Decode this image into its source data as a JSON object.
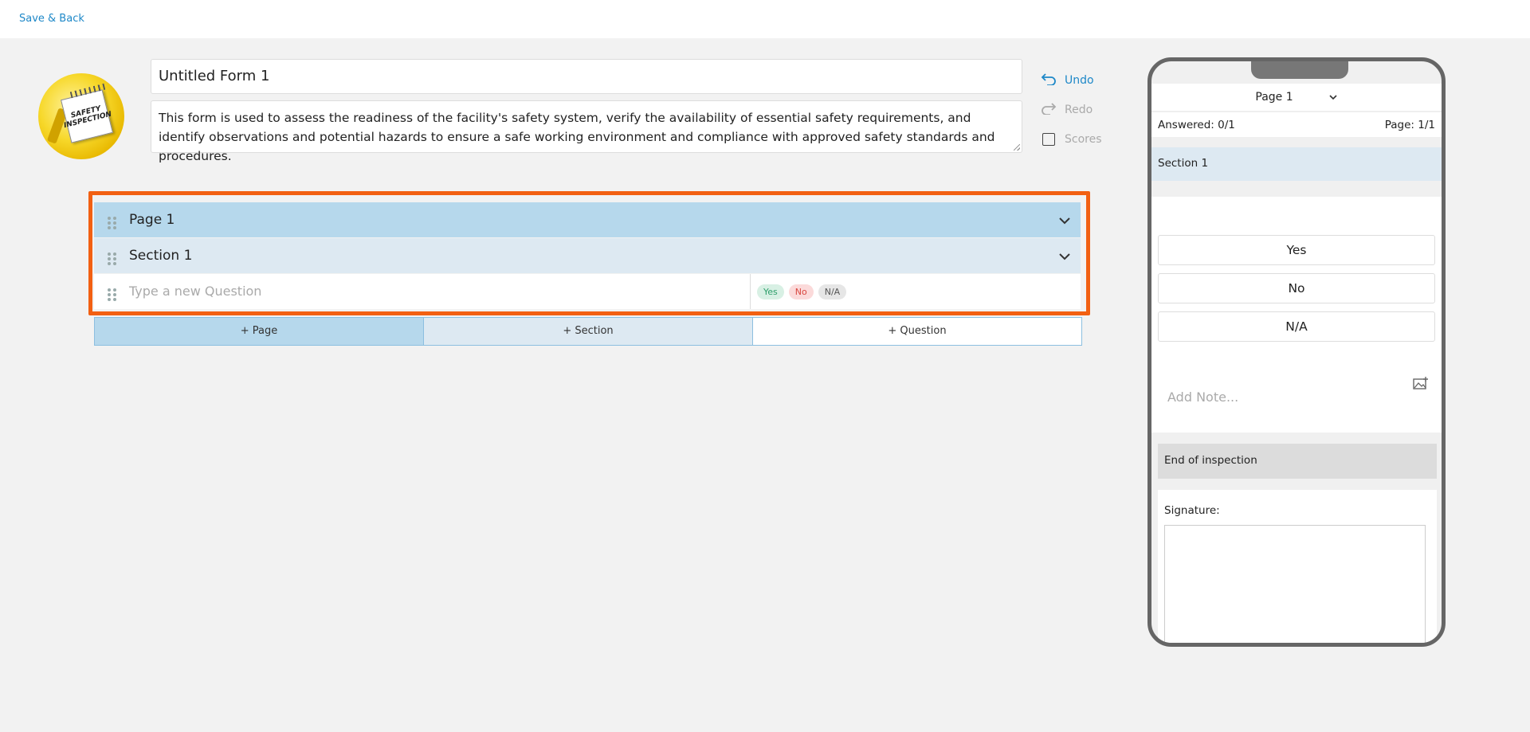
{
  "topbar": {
    "save_back_label": "Save & Back"
  },
  "form": {
    "title": "Untitled Form 1",
    "description": "This form is used to assess the readiness of the facility's safety system, verify the availability of essential safety requirements, and identify observations and potential hazards to ensure a safe working environment and compliance with approved safety standards and procedures."
  },
  "logo": {
    "line1": "SAFETY",
    "line2": "INSPECTION"
  },
  "side_actions": {
    "undo": "Undo",
    "redo": "Redo",
    "scores": "Scores"
  },
  "builder": {
    "page_label": "Page 1",
    "section_label": "Section 1",
    "question_placeholder": "Type a new Question",
    "answers": [
      "Yes",
      "No",
      "N/A"
    ]
  },
  "add_bar": {
    "page": "+ Page",
    "section": "+ Section",
    "question": "+ Question"
  },
  "preview": {
    "page_select": "Page 1",
    "answered": "Answered: 0/1",
    "page_count": "Page: 1/1",
    "section": "Section 1",
    "options": [
      "Yes",
      "No",
      "N/A"
    ],
    "note_placeholder": "Add Note...",
    "end_label": "End of inspection",
    "signature_label": "Signature:"
  },
  "colors": {
    "accent": "#1e88c8",
    "highlight": "#f26012",
    "page_row": "#b6d8ec",
    "section_row": "#dde9f2"
  }
}
